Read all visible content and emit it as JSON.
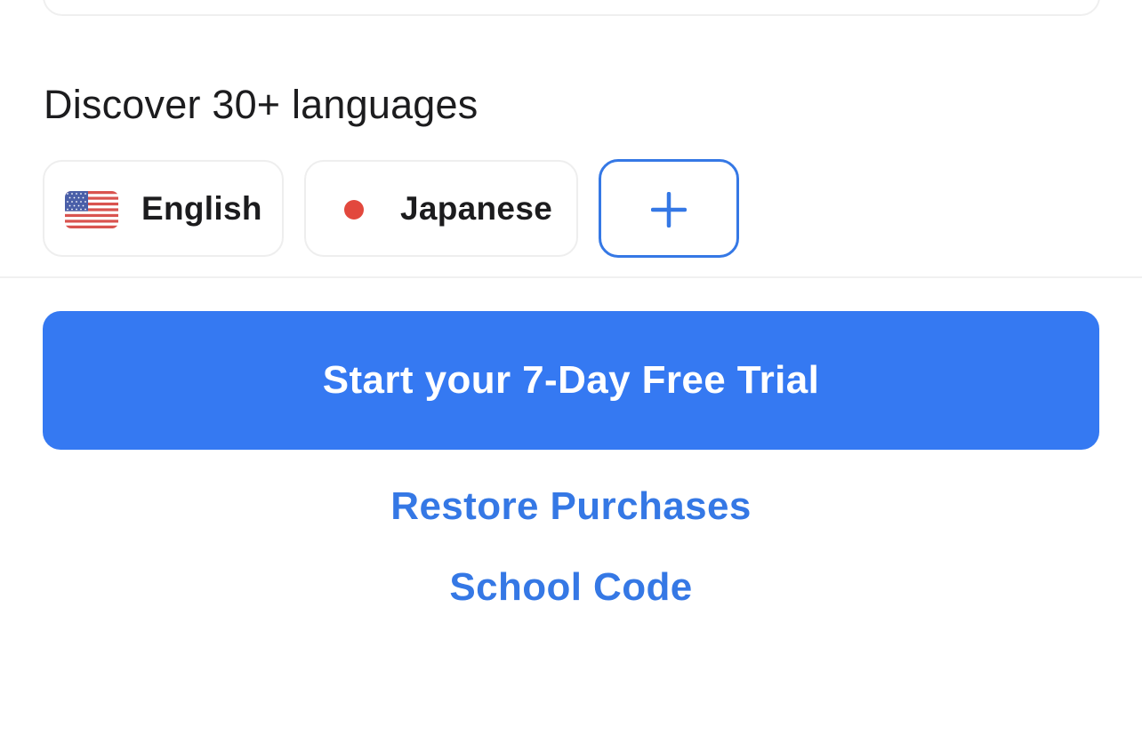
{
  "languages_section": {
    "title": "Discover 30+ languages",
    "chips": [
      {
        "label": "English",
        "icon": "us-flag-icon"
      },
      {
        "label": "Japanese",
        "icon": "japan-flag-icon"
      }
    ],
    "add_icon": "plus-icon"
  },
  "actions": {
    "trial_label": "Start your 7-Day Free Trial",
    "restore_label": "Restore Purchases",
    "school_code_label": "School Code"
  },
  "colors": {
    "accent": "#3579f2",
    "link": "#3578e5",
    "japan_red": "#e2483d"
  }
}
